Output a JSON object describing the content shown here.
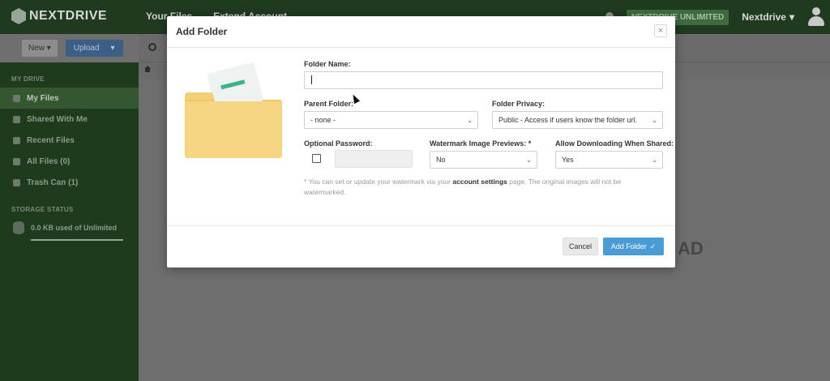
{
  "app": {
    "logo_text": "NEXTDRIVE",
    "nav": [
      "Your Files",
      "Extend Account"
    ],
    "plan_badge": "NEXTDRIVE UNLIMITED",
    "user_name": "Nextdrive",
    "bell_icon": "bell-icon",
    "avatar_icon": "user-avatar-icon"
  },
  "toolbar": {
    "new_label": "New",
    "upload_label": "Upload"
  },
  "sidebar": {
    "section_title": "MY DRIVE",
    "items": [
      {
        "label": "My Files",
        "icon": "folder-icon",
        "active": true
      },
      {
        "label": "Shared With Me",
        "icon": "users-icon",
        "active": false
      },
      {
        "label": "Recent Files",
        "icon": "clock-icon",
        "active": false
      },
      {
        "label": "All Files (0)",
        "icon": "globe-icon",
        "active": false
      },
      {
        "label": "Trash Can (1)",
        "icon": "trash-icon",
        "active": false
      }
    ],
    "storage_title": "STORAGE STATUS",
    "storage_text": "0.0 KB used of Unlimited"
  },
  "background_text": "AD",
  "modal": {
    "title": "Add Folder",
    "close_glyph": "×",
    "folder_name_label": "Folder Name:",
    "folder_name_value": "",
    "parent_folder_label": "Parent Folder:",
    "parent_folder_value": "- none -",
    "folder_privacy_label": "Folder Privacy:",
    "folder_privacy_value": "Public - Access if users know the folder url.",
    "optional_password_label": "Optional Password:",
    "watermark_label": "Watermark Image Previews: *",
    "watermark_value": "No",
    "allow_download_label": "Allow Downloading When Shared:",
    "allow_download_value": "Yes",
    "note_prefix": "* You can set or update your watermark via your",
    "note_link": "account settings",
    "note_suffix": "page. The original images will not be watermarked.",
    "cancel_label": "Cancel",
    "add_label": "Add Folder",
    "add_glyph": "✓"
  },
  "colors": {
    "primary_button": "#4a9bd6",
    "sidebar_bg": "#1e3b1e",
    "folder_yellow": "#f5d57f",
    "paper_stripe": "#3eb28f"
  }
}
